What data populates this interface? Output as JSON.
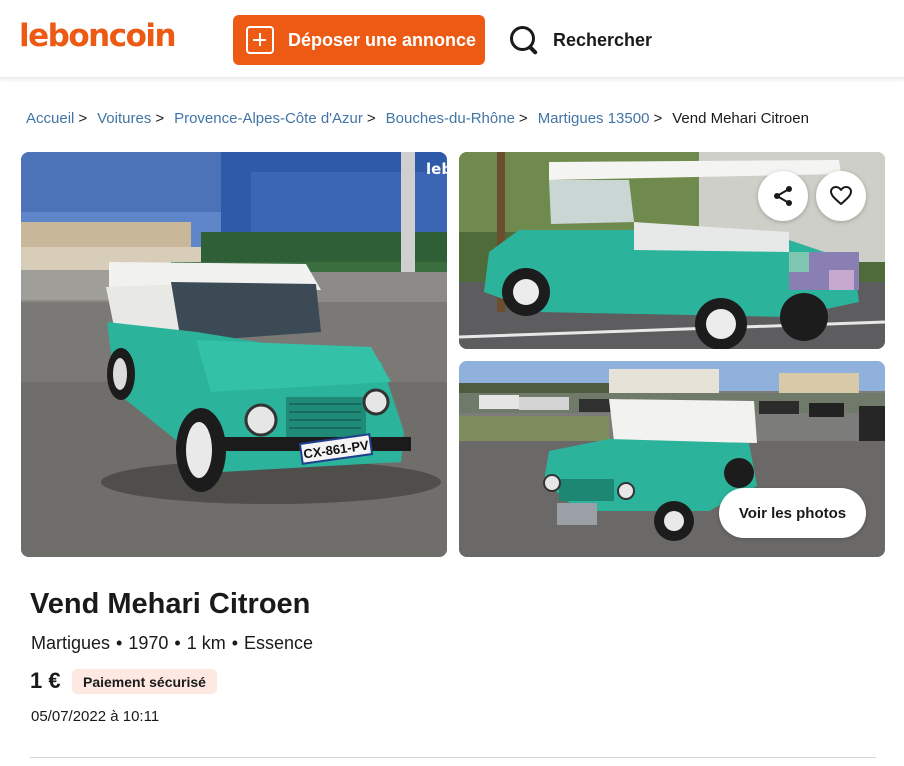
{
  "header": {
    "logo": "leboncoin",
    "post_button_label": "Déposer une annonce",
    "search_label": "Rechercher"
  },
  "breadcrumb": {
    "links": [
      "Accueil",
      "Voitures",
      "Provence-Alpes-Côte d'Azur",
      "Bouches-du-Rhône",
      "Martigues 13500"
    ],
    "current": "Vend Mehari Citroen"
  },
  "gallery": {
    "main_plate": "CX-861-PV",
    "watermark": "leb",
    "voir_photos_label": "Voir les photos"
  },
  "listing": {
    "title": "Vend Mehari Citroen",
    "city": "Martigues",
    "year": "1970",
    "mileage": "1 km",
    "fuel": "Essence",
    "separator": "•",
    "price": "1 €",
    "badge": "Paiement sécurisé",
    "date": "05/07/2022 à 10:11"
  },
  "colors": {
    "brand": "#ec5a13",
    "link": "#4275a6",
    "car": "#2bb39b",
    "badge_bg": "#fde9e1"
  }
}
